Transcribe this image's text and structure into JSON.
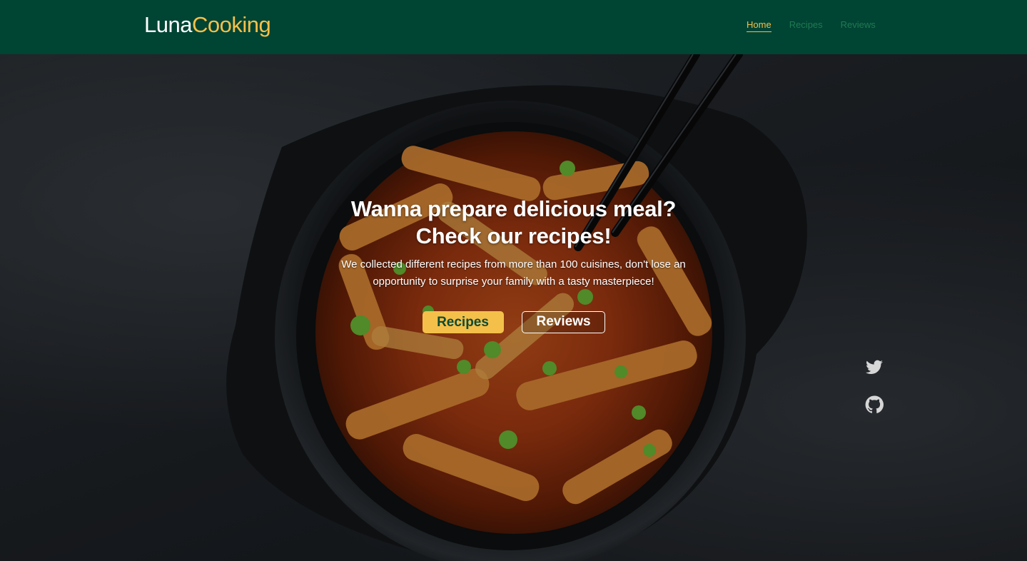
{
  "brand": {
    "part1": "Luna",
    "part2": "Cooking"
  },
  "nav": {
    "items": [
      {
        "label": "Home",
        "active": true
      },
      {
        "label": "Recipes",
        "active": false
      },
      {
        "label": "Reviews",
        "active": false
      }
    ]
  },
  "hero": {
    "title_line1": "Wanna prepare delicious meal?",
    "title_line2": "Check our recipes!",
    "subtitle": "We collected different recipes from more than 100 cuisines, don't lose an opportunity to surprise your family with a tasty masterpiece!",
    "primary_button": "Recipes",
    "secondary_button": "Reviews"
  },
  "social": {
    "icons": [
      "twitter-icon",
      "github-icon"
    ]
  },
  "colors": {
    "header_bg": "#004433",
    "accent": "#f4c04a",
    "nav_inactive": "#1f7a52",
    "text_light": "#ffffff"
  }
}
